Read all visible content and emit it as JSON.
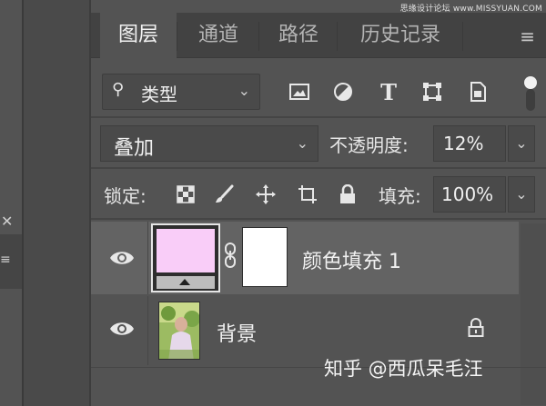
{
  "watermark_top": "思缘设计论坛 www.MISSYUAN.COM",
  "tabs": [
    {
      "label": "图层",
      "active": true
    },
    {
      "label": "通道",
      "active": false
    },
    {
      "label": "路径",
      "active": false
    },
    {
      "label": "历史记录",
      "active": false
    }
  ],
  "filter": {
    "kind_label": "类型",
    "icons": [
      "image-filter-icon",
      "adjustment-filter-icon",
      "type-filter-icon",
      "shape-filter-icon",
      "smart-object-filter-icon"
    ]
  },
  "blend": {
    "mode": "叠加",
    "opacity_label": "不透明度:",
    "opacity_value": "12%"
  },
  "lock": {
    "label": "锁定:",
    "icons": [
      "lock-transparent-pixels-icon",
      "lock-image-pixels-icon",
      "lock-position-icon",
      "lock-artboard-icon",
      "lock-all-icon"
    ],
    "fill_label": "填充:",
    "fill_value": "100%"
  },
  "layers": [
    {
      "name": "颜色填充 1",
      "selected": true,
      "visible": true,
      "fill_color": "#f9cdf8"
    },
    {
      "name": "背景",
      "selected": false,
      "visible": true,
      "locked": true
    }
  ],
  "watermark_bottom": "知乎 @西瓜呆毛汪",
  "colors": {
    "panel_bg": "#535353",
    "tab_bg": "#424242",
    "selected_layer": "#636363"
  }
}
